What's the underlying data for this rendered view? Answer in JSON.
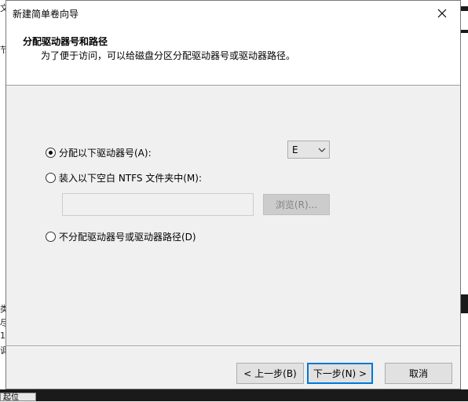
{
  "background": {
    "left_fragments": [
      "文",
      "节",
      "类",
      "尽",
      "1",
      "调"
    ],
    "bottom_tab": "起位"
  },
  "dialog": {
    "title": "新建简单卷向导",
    "close_icon": "close-icon",
    "header": {
      "title": "分配驱动器号和路径",
      "description": "为了便于访问，可以给磁盘分区分配驱动器号或驱动器路径。"
    },
    "options": {
      "assign_letter": {
        "label": "分配以下驱动器号(A):",
        "checked": true
      },
      "mount_folder": {
        "label": "装入以下空白 NTFS 文件夹中(M):",
        "checked": false
      },
      "no_assign": {
        "label": "不分配驱动器号或驱动器路径(D)",
        "checked": false
      }
    },
    "drive_letter": {
      "selected": "E"
    },
    "folder_path": {
      "value": ""
    },
    "browse_button": "浏览(R)...",
    "buttons": {
      "back": "< 上一步(B)",
      "next": "下一步(N) >",
      "cancel": "取消"
    }
  }
}
